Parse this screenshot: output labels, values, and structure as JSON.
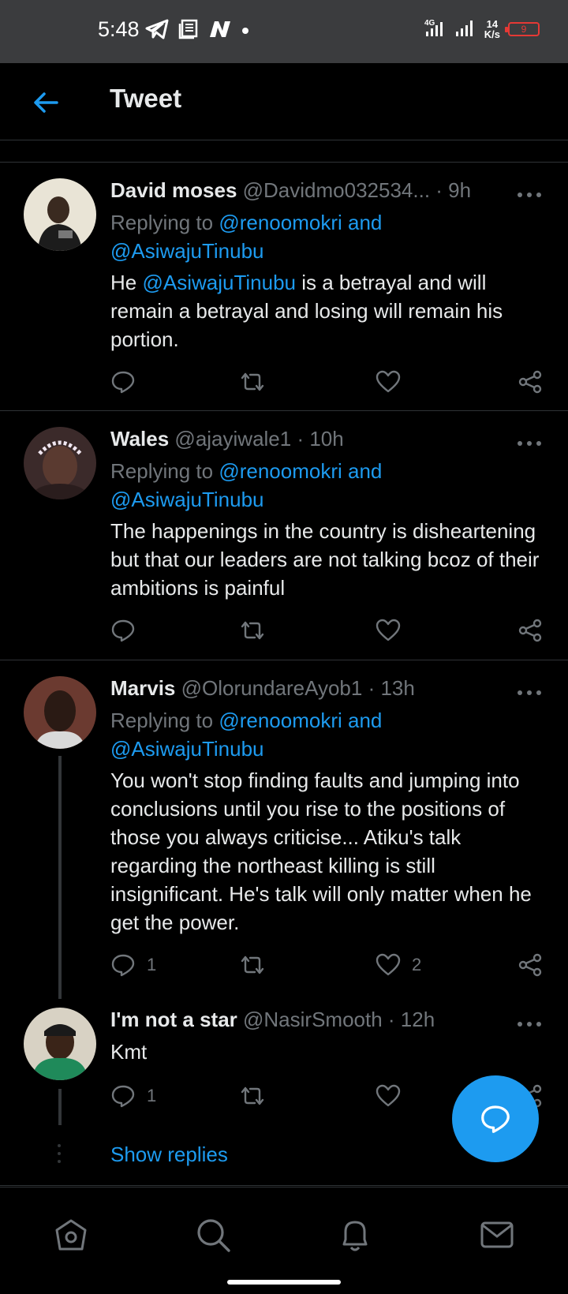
{
  "status_bar": {
    "time": "5:48",
    "network_type": "4G",
    "net_speed_value": "14",
    "net_speed_unit": "K/s",
    "battery_level": "9"
  },
  "header": {
    "title": "Tweet"
  },
  "tweets": [
    {
      "name": "David moses",
      "handle": "@Davidmo032534...",
      "time": "· 9h",
      "replying_prefix": "Replying to",
      "replying_to": "@renoomokri and",
      "replying_to_2": "@AsiwajuTinubu",
      "body_pre": "He",
      "body_mention": "@AsiwajuTinubu",
      "body_post": "is a betrayal and will remain a betrayal and losing will remain his portion.",
      "reply_count": "",
      "like_count": ""
    },
    {
      "name": "Wales",
      "handle": "@ajayiwale1",
      "time": "· 10h",
      "replying_prefix": "Replying to",
      "replying_to": "@renoomokri and",
      "replying_to_2": "@AsiwajuTinubu",
      "body": "The happenings in the country is disheartening but that our leaders are not talking bcoz of their ambitions is painful",
      "reply_count": "",
      "like_count": ""
    },
    {
      "name": "Marvis",
      "handle": "@OlorundareAyob1",
      "time": "· 13h",
      "replying_prefix": "Replying to",
      "replying_to": "@renoomokri and",
      "replying_to_2": "@AsiwajuTinubu",
      "body": "You won't stop finding faults and jumping into conclusions until you rise to the positions of those you always criticise... Atiku's talk regarding the northeast killing is still insignificant. He's talk will only matter when he get the power.",
      "reply_count": "1",
      "like_count": "2"
    },
    {
      "name": "I'm not a star",
      "handle": "@NasirSmooth",
      "time": "· 12h",
      "body": "Kmt",
      "reply_count": "1",
      "like_count": ""
    }
  ],
  "show_replies_label": "Show replies",
  "icons": {
    "back": "back-arrow-icon",
    "reply": "reply-icon",
    "retweet": "retweet-icon",
    "like": "heart-icon",
    "share": "share-icon",
    "more": "more-icon",
    "compose": "compose-reply-icon",
    "nav_home": "home-icon",
    "nav_search": "search-icon",
    "nav_notifications": "bell-icon",
    "nav_messages": "mail-icon"
  },
  "colors": {
    "accent": "#1d9bf0",
    "background": "#000000",
    "muted": "#71767b",
    "status_bar": "#3b3c3e"
  }
}
